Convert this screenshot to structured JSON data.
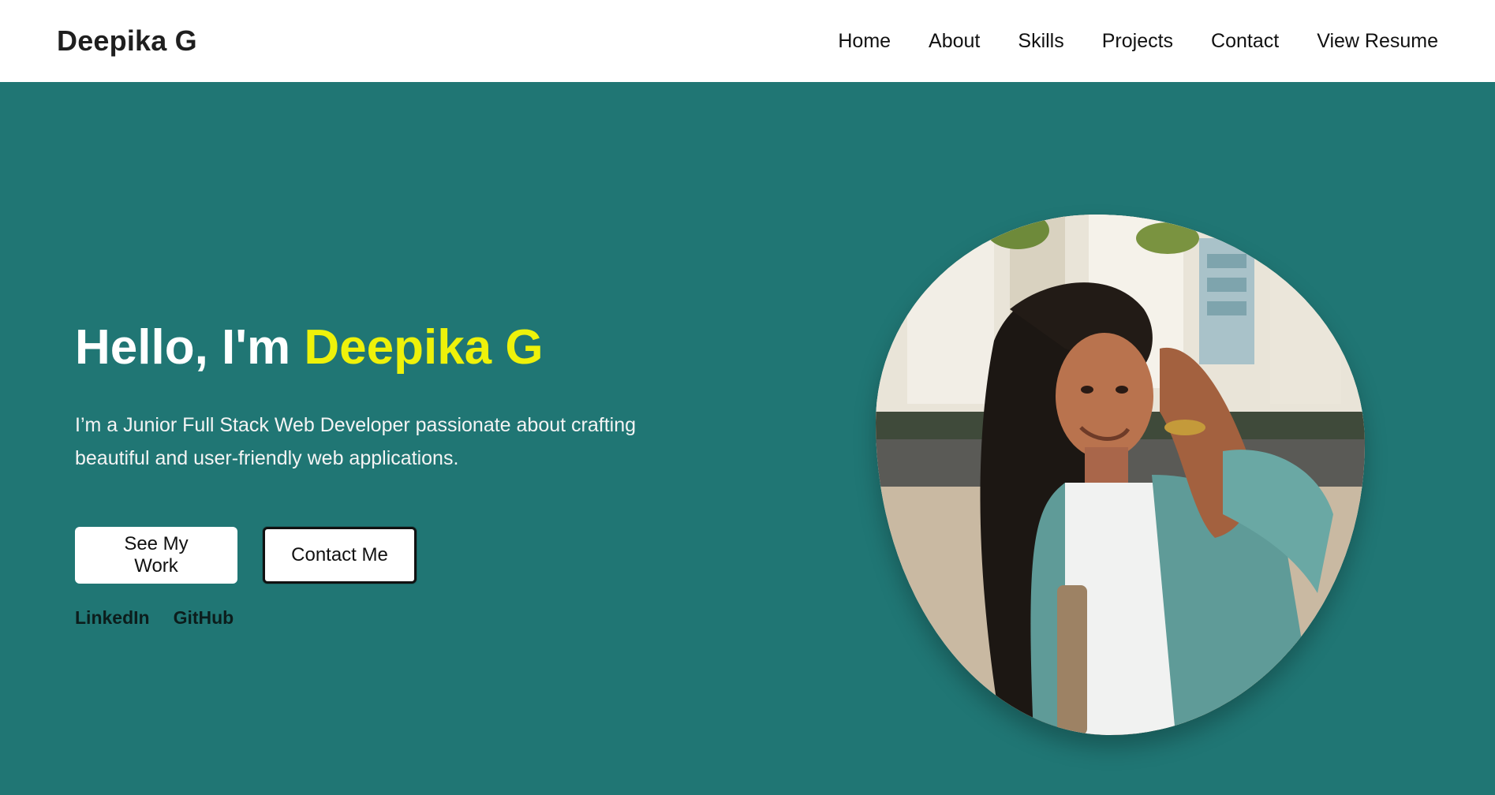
{
  "brand": {
    "name": "Deepika G"
  },
  "nav": {
    "items": [
      {
        "label": "Home"
      },
      {
        "label": "About"
      },
      {
        "label": "Skills"
      },
      {
        "label": "Projects"
      },
      {
        "label": "Contact"
      },
      {
        "label": "View Resume"
      }
    ]
  },
  "hero": {
    "greeting": "Hello, I'm ",
    "name": "Deepika G",
    "subtitle": "I’m a Junior Full Stack Web Developer passionate about crafting beautiful and user-friendly web applications.",
    "buttons": {
      "primary": "See My Work",
      "secondary": "Contact Me"
    },
    "social": {
      "linkedin": "LinkedIn",
      "github": "GitHub"
    }
  },
  "colors": {
    "hero_bg": "#207674",
    "accent": "#eef20a",
    "navbar_bg": "#ffffff"
  }
}
